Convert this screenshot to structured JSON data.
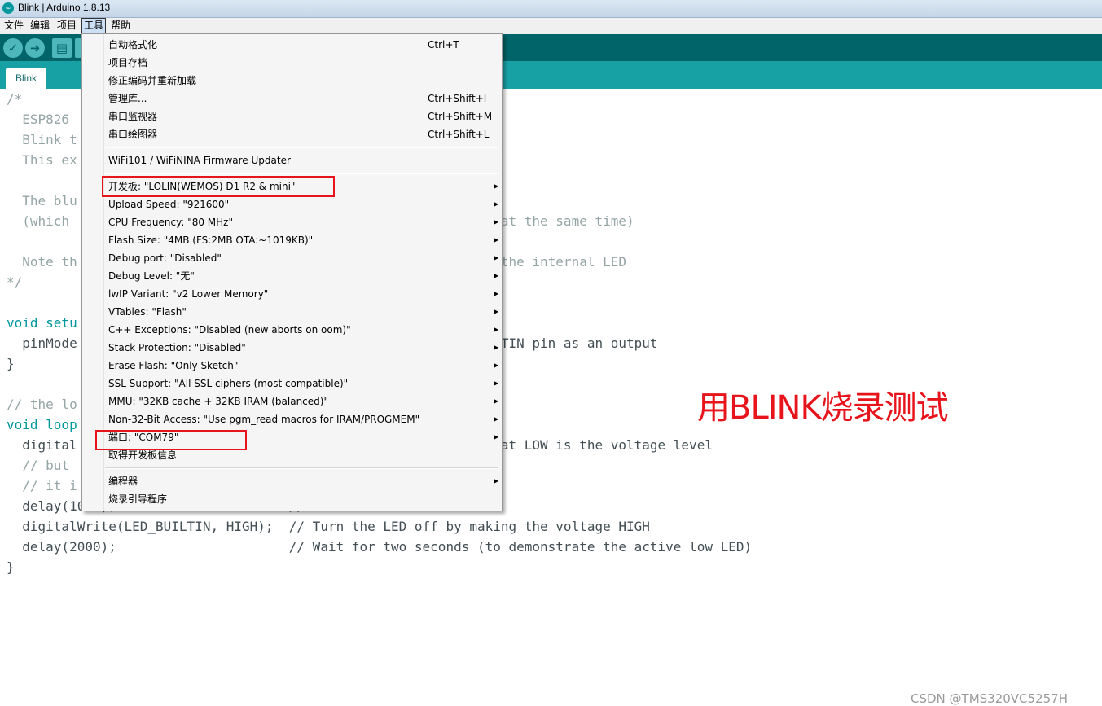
{
  "window": {
    "title": "Blink | Arduino 1.8.13",
    "app_icon": "arduino-icon"
  },
  "menubar": {
    "items": [
      "文件",
      "编辑",
      "项目",
      "工具",
      "帮助"
    ],
    "active": "工具"
  },
  "toolbar": {
    "buttons": [
      {
        "name": "verify",
        "icon": "check-icon",
        "glyph": "✓"
      },
      {
        "name": "upload",
        "icon": "arrow-right-icon",
        "glyph": "➜"
      },
      {
        "name": "new",
        "icon": "new-file-icon",
        "glyph": "▤"
      },
      {
        "name": "open",
        "icon": "open-icon",
        "glyph": "▲"
      }
    ]
  },
  "tabs": [
    {
      "label": "Blink",
      "active": true
    }
  ],
  "editor": {
    "lines": [
      {
        "text": "/*",
        "class": "cmt"
      },
      {
        "text": "  ESP826",
        "class": "cmt"
      },
      {
        "text": "  Blink t",
        "class": "cmt"
      },
      {
        "text": "  This ex",
        "class": "cmt"
      },
      {
        "text": "",
        "class": ""
      },
      {
        "text": "  The blu                                                D1",
        "class": "cmt"
      },
      {
        "text": "  (which                                                rint() at the same time)",
        "class": "cmt"
      },
      {
        "text": "",
        "class": ""
      },
      {
        "text": "  Note th                                               n with the internal LED",
        "class": "cmt"
      },
      {
        "text": "*/",
        "class": "cmt"
      },
      {
        "text": "",
        "class": ""
      },
      {
        "text": "void setu",
        "class": "kw"
      },
      {
        "text": "  pinMode                                               ED_BUILTIN pin as an output",
        "class": ""
      },
      {
        "text": "}",
        "class": ""
      },
      {
        "text": "",
        "class": ""
      },
      {
        "text": "// the lo",
        "class": "cmt"
      },
      {
        "text": "void loop",
        "class": "kw"
      },
      {
        "text": "  digital                                              (Note that LOW is the voltage level",
        "class": ""
      },
      {
        "text": "  // but",
        "class": "cmt"
      },
      {
        "text": "  // it i",
        "class": "cmt"
      },
      {
        "text": "  delay(1000);                      // Wait for a second",
        "class": ""
      },
      {
        "text": "  digitalWrite(LED_BUILTIN, HIGH);  // Turn the LED off by making the voltage HIGH",
        "class": ""
      },
      {
        "text": "  delay(2000);                      // Wait for two seconds (to demonstrate the active low LED)",
        "class": ""
      },
      {
        "text": "}",
        "class": ""
      }
    ]
  },
  "tools_menu": {
    "items": [
      {
        "label": "自动格式化",
        "shortcut": "Ctrl+T"
      },
      {
        "label": "项目存档",
        "shortcut": ""
      },
      {
        "label": "修正编码并重新加载",
        "shortcut": ""
      },
      {
        "label": "管理库...",
        "shortcut": "Ctrl+Shift+I"
      },
      {
        "label": "串口监视器",
        "shortcut": "Ctrl+Shift+M"
      },
      {
        "label": "串口绘图器",
        "shortcut": "Ctrl+Shift+L"
      },
      {
        "separator": true
      },
      {
        "label": "WiFi101 / WiFiNINA Firmware Updater",
        "shortcut": ""
      },
      {
        "separator": true
      },
      {
        "label": "开发板: \"LOLIN(WEMOS) D1 R2 & mini\"",
        "submenu": true
      },
      {
        "label": "Upload Speed: \"921600\"",
        "submenu": true
      },
      {
        "label": "CPU Frequency: \"80 MHz\"",
        "submenu": true
      },
      {
        "label": "Flash Size: \"4MB (FS:2MB OTA:~1019KB)\"",
        "submenu": true
      },
      {
        "label": "Debug port: \"Disabled\"",
        "submenu": true
      },
      {
        "label": "Debug Level: \"无\"",
        "submenu": true
      },
      {
        "label": "lwIP Variant: \"v2 Lower Memory\"",
        "submenu": true
      },
      {
        "label": "VTables: \"Flash\"",
        "submenu": true
      },
      {
        "label": "C++ Exceptions: \"Disabled (new aborts on oom)\"",
        "submenu": true
      },
      {
        "label": "Stack Protection: \"Disabled\"",
        "submenu": true
      },
      {
        "label": "Erase Flash: \"Only Sketch\"",
        "submenu": true
      },
      {
        "label": "SSL Support: \"All SSL ciphers (most compatible)\"",
        "submenu": true
      },
      {
        "label": "MMU: \"32KB cache + 32KB IRAM (balanced)\"",
        "submenu": true
      },
      {
        "label": "Non-32-Bit Access: \"Use pgm_read macros for IRAM/PROGMEM\"",
        "submenu": true
      },
      {
        "label": "端口: \"COM79\"",
        "submenu": true
      },
      {
        "label": "取得开发板信息",
        "shortcut": ""
      },
      {
        "separator": true
      },
      {
        "label": "编程器",
        "submenu": true
      },
      {
        "label": "烧录引导程序",
        "shortcut": ""
      }
    ]
  },
  "annotation": {
    "text": "用BLINK烧录测试",
    "color": "#e8141b"
  },
  "watermark": "CSDN @TMS320VC5257H",
  "colors": {
    "toolbar": "#006468",
    "tabstrip": "#17a1a5",
    "highlight": "#e8141b"
  }
}
